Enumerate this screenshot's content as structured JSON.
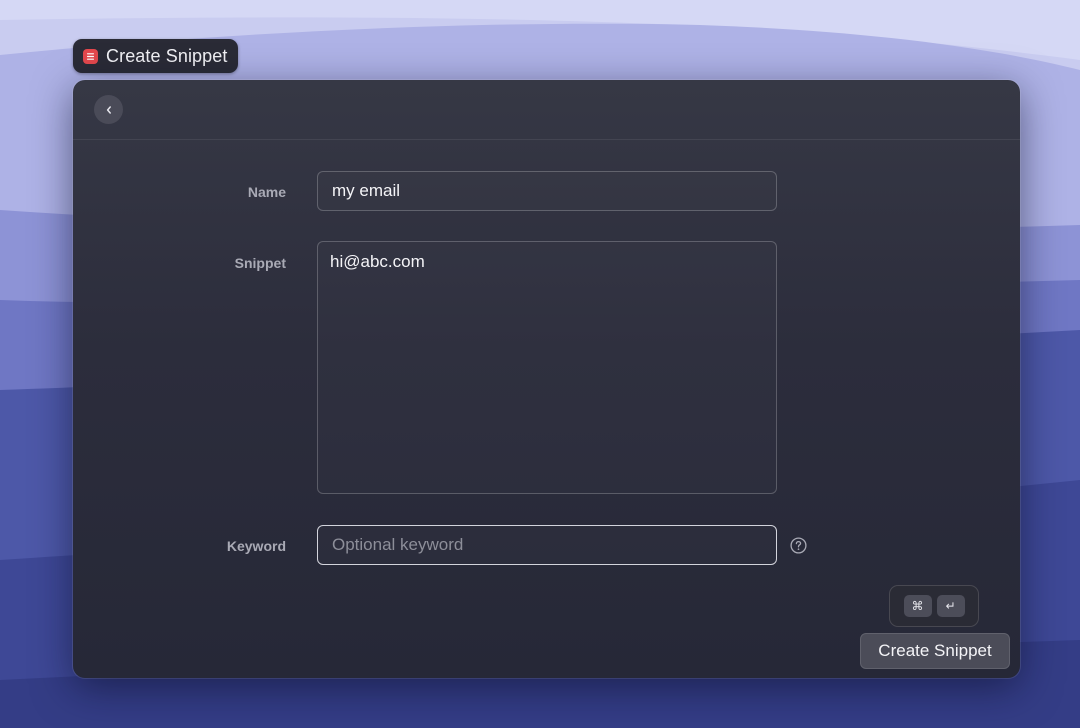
{
  "window_title": {
    "icon": "snippet-app-icon",
    "text": "Create Snippet"
  },
  "toolbar": {
    "back_icon": "chevron-left-icon"
  },
  "form": {
    "name": {
      "label": "Name",
      "value": "my email"
    },
    "snippet": {
      "label": "Snippet",
      "value": "hi@abc.com"
    },
    "keyword": {
      "label": "Keyword",
      "value": "",
      "placeholder": "Optional keyword",
      "help_icon": "question-circle-icon"
    }
  },
  "footer": {
    "shortcut_keys": [
      "⌘",
      "↵"
    ],
    "submit_label": "Create Snippet"
  },
  "colors": {
    "app_icon": "#e5484d",
    "window_background": "#2c2d3c",
    "button_background": "#4b4c58"
  }
}
